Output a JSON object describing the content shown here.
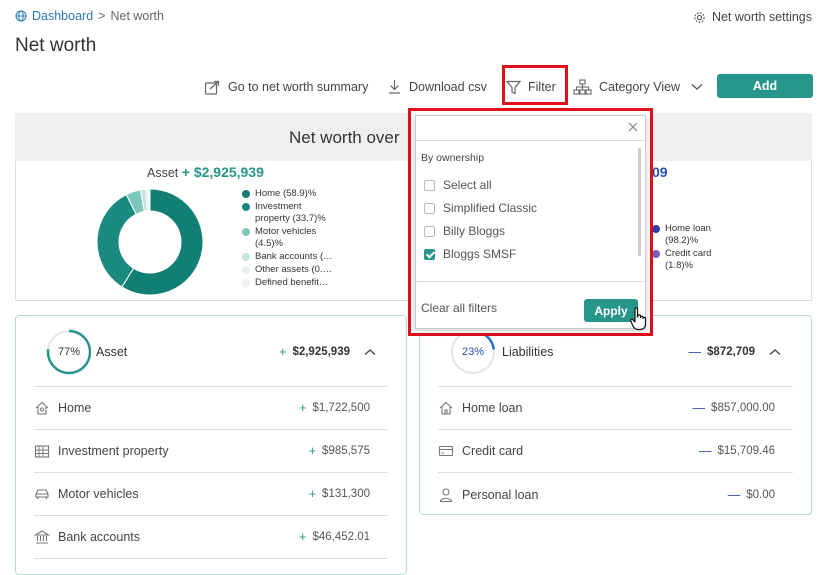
{
  "breadcrumb": {
    "home": "Dashboard",
    "sep": ">",
    "current": "Net worth"
  },
  "header": {
    "settings_label": "Net worth settings",
    "title": "Net worth"
  },
  "toolbar": {
    "summary_label": "Go to net worth summary",
    "download_label": "Download csv",
    "filter_label": "Filter",
    "category_view_label": "Category View",
    "add_label": "Add"
  },
  "overview": {
    "title": "Net worth over",
    "asset_label": "Asset",
    "asset_total": "+ $2,925,939",
    "liab_total_partial": "09",
    "asset_legend": [
      {
        "label": "Home (58.9)%",
        "color": "#127f74"
      },
      {
        "label": "Investment property (33.7)%",
        "color": "#1a8a80"
      },
      {
        "label": "Motor vehicles (4.5)%",
        "color": "#7fc6bd"
      },
      {
        "label": "Bank accounts (…",
        "color": "#c6e5e0"
      },
      {
        "label": "Other assets (0.…",
        "color": "#e2f1ef"
      },
      {
        "label": "Defined benefit…",
        "color": "#f0f0f0"
      }
    ],
    "liab_legend": [
      {
        "label": "Home loan (98.2)%",
        "color": "#2a3fa0"
      },
      {
        "label": "Credit card (1.8)%",
        "color": "#7a5cc0"
      }
    ],
    "asset_pie": [
      58.9,
      33.7,
      4.5,
      1.6,
      0.8,
      0.5
    ]
  },
  "asset_panel": {
    "percent": "77%",
    "title": "Asset",
    "sign": "+",
    "total": "$2,925,939",
    "rows": [
      {
        "icon": "home-icon",
        "label": "Home",
        "sign": "+",
        "value": "$1,722,500"
      },
      {
        "icon": "building-icon",
        "label": "Investment property",
        "sign": "+",
        "value": "$985,575"
      },
      {
        "icon": "car-icon",
        "label": "Motor vehicles",
        "sign": "+",
        "value": "$131,300"
      },
      {
        "icon": "bank-icon",
        "label": "Bank accounts",
        "sign": "+",
        "value": "$46,452.01"
      }
    ]
  },
  "liab_panel": {
    "percent": "23%",
    "title": "Liabilities",
    "sign": "—",
    "total": "$872,709",
    "rows": [
      {
        "icon": "home-icon",
        "label": "Home loan",
        "sign": "—",
        "value": "$857,000.00"
      },
      {
        "icon": "credit-card-icon",
        "label": "Credit card",
        "sign": "—",
        "value": "$15,709.46"
      },
      {
        "icon": "person-icon",
        "label": "Personal loan",
        "sign": "—",
        "value": "$0.00"
      }
    ]
  },
  "filter_dropdown": {
    "section_title": "By ownership",
    "options": [
      {
        "label": "Select all",
        "checked": false
      },
      {
        "label": "Simplified Classic",
        "checked": false
      },
      {
        "label": "Billy Bloggs",
        "checked": false
      },
      {
        "label": "Bloggs SMSF",
        "checked": true
      }
    ],
    "clear_label": "Clear all filters",
    "apply_label": "Apply"
  },
  "colors": {
    "accent": "#26968a",
    "highlight": "#e0101a",
    "link": "#2a78b8",
    "liability": "#2a4fb0"
  }
}
